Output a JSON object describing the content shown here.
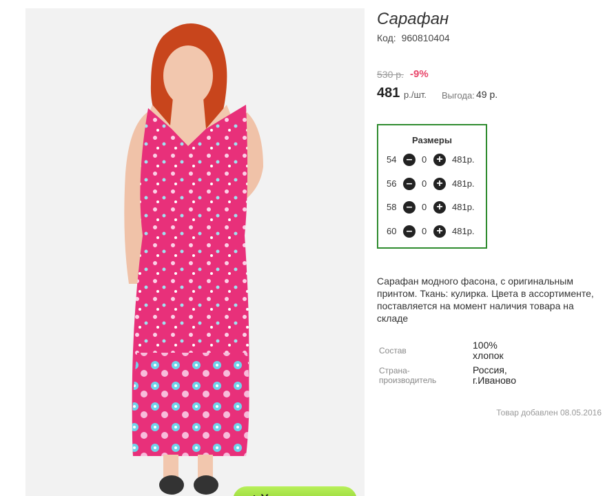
{
  "product": {
    "title": "Сарафан",
    "code_label": "Код:",
    "code_value": "960810404",
    "old_price": "530 р.",
    "discount": "-9%",
    "price": "481",
    "price_unit": "р./шт.",
    "benefit_label": "Выгода:",
    "benefit_value": "49 р.",
    "description": "Сарафан модного фасона, с оригинальным принтом. Ткань: кулирка. Цвета в ассортименте, поставляется на момент наличия товара на складе",
    "added": "Товар добавлен 08.05.2016"
  },
  "sizes": {
    "title": "Размеры",
    "rows": [
      {
        "size": "54",
        "qty": "0",
        "price": "481р."
      },
      {
        "size": "56",
        "qty": "0",
        "price": "481р."
      },
      {
        "size": "58",
        "qty": "0",
        "price": "481р."
      },
      {
        "size": "60",
        "qty": "0",
        "price": "481р."
      }
    ]
  },
  "props": {
    "composition_label": "Состав",
    "composition_value": "100% хлопок",
    "country_label": "Страна-производитель",
    "country_value": "Россия, г.Иваново"
  },
  "photo": {
    "zoom_label": "+ Увеличить",
    "dress_color": "#e8307a",
    "hair_color": "#c8451c"
  }
}
